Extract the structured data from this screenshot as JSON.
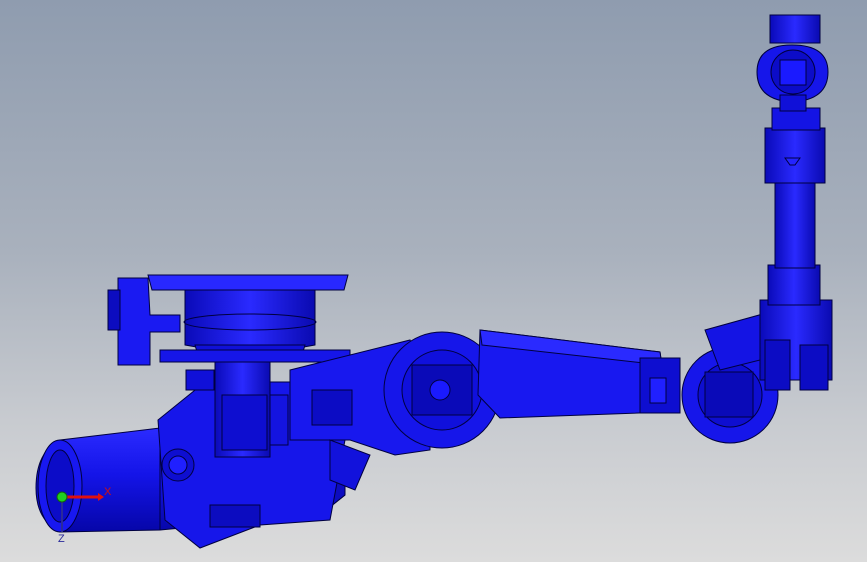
{
  "viewport": {
    "background_top": "#8f9caf",
    "background_bottom": "#dcdcdc",
    "model_color": "#1010e8",
    "edge_color": "#000040"
  },
  "triad": {
    "x_label": "X",
    "z_label": "Z",
    "x_color": "#e01010",
    "origin_color": "#20d020",
    "z_color": "#2a2a9a"
  }
}
